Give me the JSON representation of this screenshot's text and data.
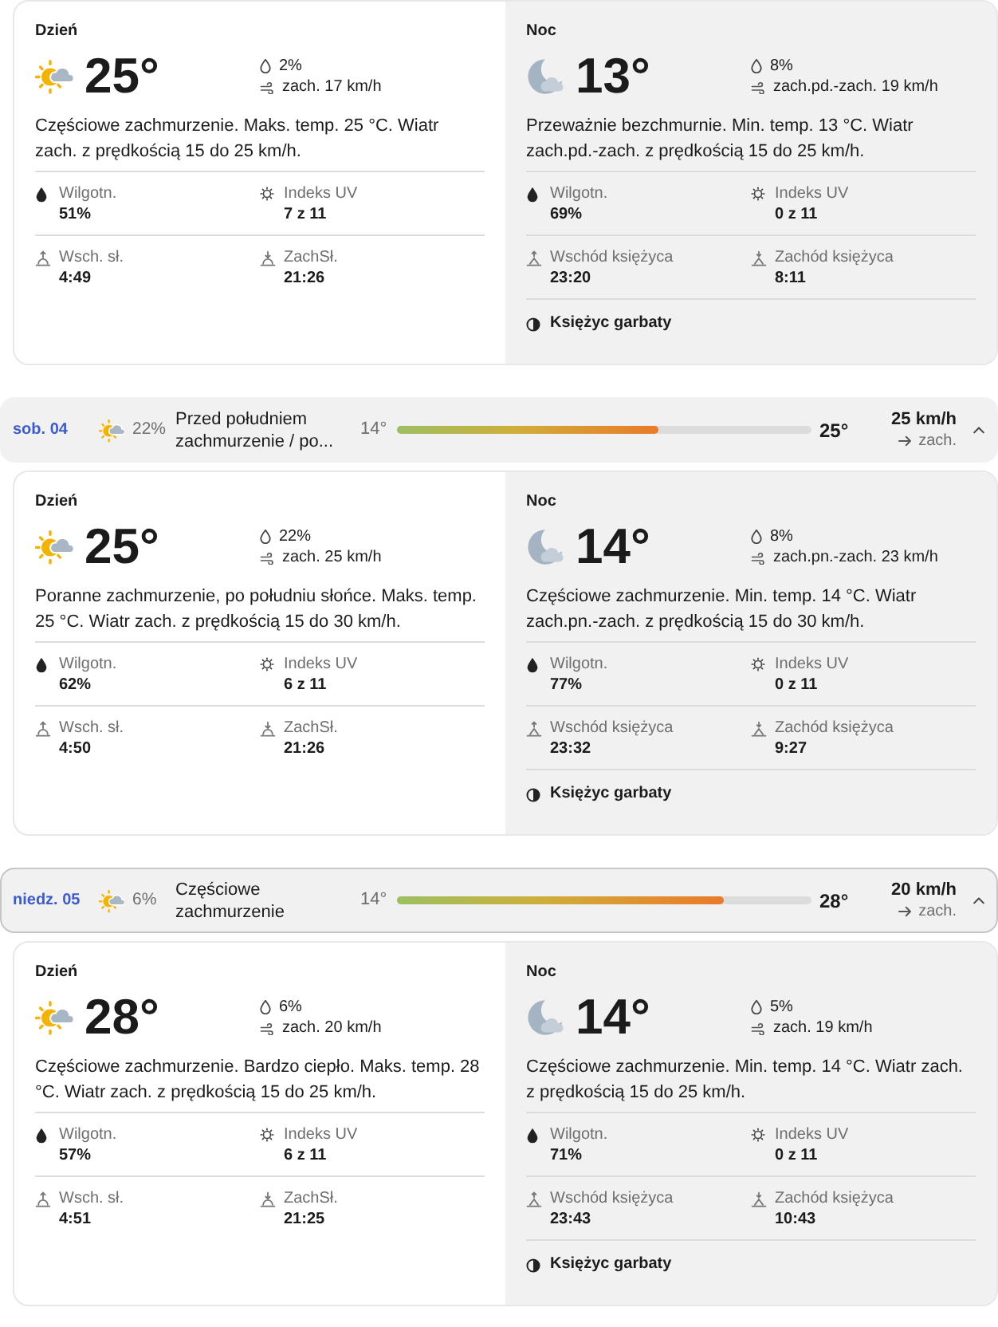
{
  "forecast": [
    {
      "day": {
        "kind": "day",
        "title": "Dzień",
        "temp": "25°",
        "precip": "2%",
        "wind": "zach. 17 km/h",
        "text": "Częściowe zachmurzenie. Maks. temp. 25 °C. Wiatr zach. z prędkością 15 do 25 km/h.",
        "stats": [
          {
            "kind": "humidity",
            "label": "Wilgotn.",
            "value": "51%"
          },
          {
            "kind": "uv",
            "label": "Indeks UV",
            "value": "7 z 11"
          },
          {
            "kind": "sunrise",
            "label": "Wsch. sł.",
            "value": "4:49"
          },
          {
            "kind": "sunset",
            "label": "ZachSł.",
            "value": "21:26"
          }
        ]
      },
      "night": {
        "kind": "night",
        "title": "Noc",
        "temp": "13°",
        "precip": "8%",
        "wind": "zach.pd.-zach. 19 km/h",
        "text": "Przeważnie bezchmurnie. Min. temp. 13 °C. Wiatr zach.pd.-zach. z prędkością 15 do 25 km/h.",
        "stats": [
          {
            "kind": "humidity",
            "label": "Wilgotn.",
            "value": "69%"
          },
          {
            "kind": "uv",
            "label": "Indeks UV",
            "value": "0 z 11"
          },
          {
            "kind": "moonrise",
            "label": "Wschód księżyca",
            "value": "23:20"
          },
          {
            "kind": "moonset",
            "label": "Zachód księżyca",
            "value": "8:11"
          }
        ],
        "moon_phase": "Księżyc garbaty"
      }
    },
    {
      "summary": {
        "date": "sob. 04",
        "precip": "22%",
        "condition": "Przed południem zachmurzenie / po...",
        "low": "14°",
        "high": "25°",
        "level": 0.63,
        "wind": "25 km/h",
        "wind_dir": "zach.",
        "expanded": true,
        "highlighted": false
      },
      "day": {
        "kind": "day",
        "title": "Dzień",
        "temp": "25°",
        "precip": "22%",
        "wind": "zach. 25 km/h",
        "text": "Poranne zachmurzenie, po południu słońce. Maks. temp. 25 °C. Wiatr zach. z prędkością 15 do 30 km/h.",
        "stats": [
          {
            "kind": "humidity",
            "label": "Wilgotn.",
            "value": "62%"
          },
          {
            "kind": "uv",
            "label": "Indeks UV",
            "value": "6 z 11"
          },
          {
            "kind": "sunrise",
            "label": "Wsch. sł.",
            "value": "4:50"
          },
          {
            "kind": "sunset",
            "label": "ZachSł.",
            "value": "21:26"
          }
        ]
      },
      "night": {
        "kind": "night",
        "title": "Noc",
        "temp": "14°",
        "precip": "8%",
        "wind": "zach.pn.-zach. 23 km/h",
        "text": "Częściowe zachmurzenie. Min. temp. 14 °C. Wiatr zach.pn.-zach. z prędkością 15 do 30 km/h.",
        "stats": [
          {
            "kind": "humidity",
            "label": "Wilgotn.",
            "value": "77%"
          },
          {
            "kind": "uv",
            "label": "Indeks UV",
            "value": "0 z 11"
          },
          {
            "kind": "moonrise",
            "label": "Wschód księżyca",
            "value": "23:32"
          },
          {
            "kind": "moonset",
            "label": "Zachód księżyca",
            "value": "9:27"
          }
        ],
        "moon_phase": "Księżyc garbaty"
      }
    },
    {
      "summary": {
        "date": "niedz. 05",
        "precip": "6%",
        "condition": "Częściowe zachmurzenie",
        "low": "14°",
        "high": "28°",
        "level": 0.79,
        "wind": "20 km/h",
        "wind_dir": "zach.",
        "expanded": true,
        "highlighted": true
      },
      "day": {
        "kind": "day",
        "title": "Dzień",
        "temp": "28°",
        "precip": "6%",
        "wind": "zach. 20 km/h",
        "text": "Częściowe zachmurzenie. Bardzo ciepło. Maks. temp. 28 °C. Wiatr zach. z prędkością 15 do 25 km/h.",
        "stats": [
          {
            "kind": "humidity",
            "label": "Wilgotn.",
            "value": "57%"
          },
          {
            "kind": "uv",
            "label": "Indeks UV",
            "value": "6 z 11"
          },
          {
            "kind": "sunrise",
            "label": "Wsch. sł.",
            "value": "4:51"
          },
          {
            "kind": "sunset",
            "label": "ZachSł.",
            "value": "21:25"
          }
        ]
      },
      "night": {
        "kind": "night",
        "title": "Noc",
        "temp": "14°",
        "precip": "5%",
        "wind": "zach. 19 km/h",
        "text": "Częściowe zachmurzenie. Min. temp. 14 °C. Wiatr zach. z prędkością 15 do 25 km/h.",
        "stats": [
          {
            "kind": "humidity",
            "label": "Wilgotn.",
            "value": "71%"
          },
          {
            "kind": "uv",
            "label": "Indeks UV",
            "value": "0 z 11"
          },
          {
            "kind": "moonrise",
            "label": "Wschód księżyca",
            "value": "23:43"
          },
          {
            "kind": "moonset",
            "label": "Zachód księżyca",
            "value": "10:43"
          }
        ],
        "moon_phase": "Księżyc garbaty"
      }
    }
  ]
}
